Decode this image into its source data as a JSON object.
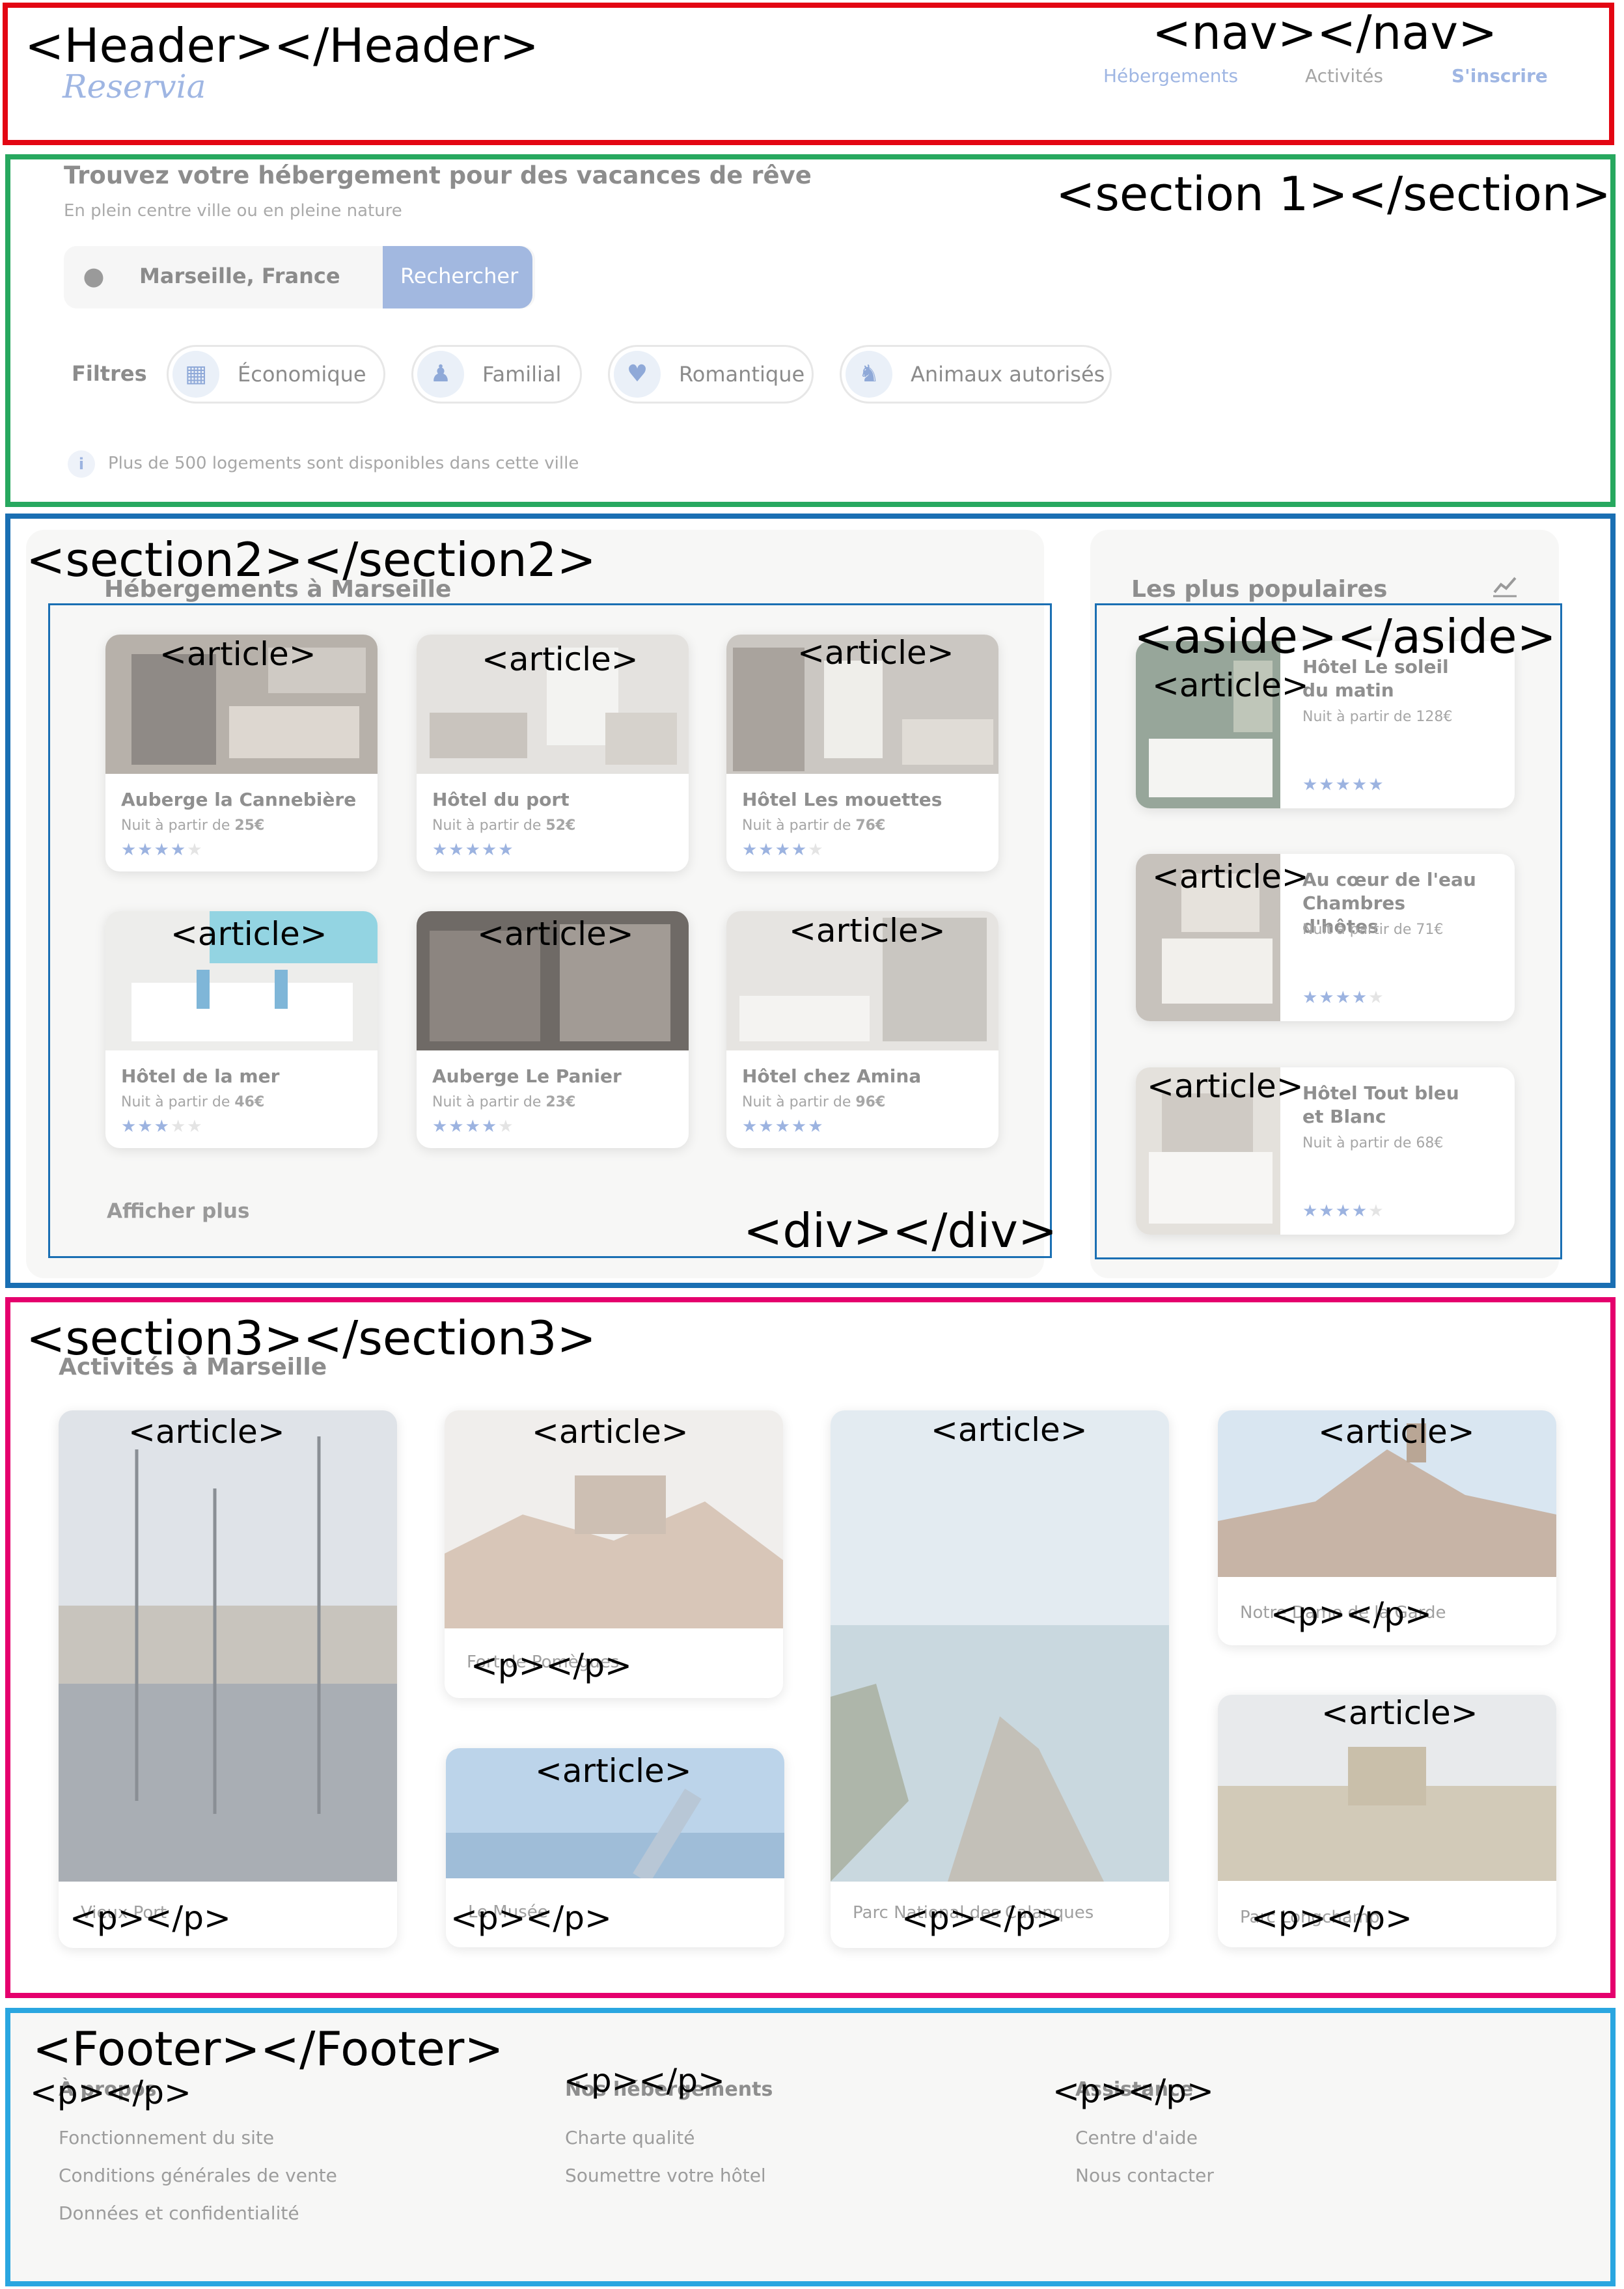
{
  "annotations": {
    "header": "<Header></Header>",
    "nav": "<nav></nav>",
    "section1": "<section 1></section>",
    "section2": "<section2></section2>",
    "aside": "<aside></aside>",
    "div": "<div></div>",
    "section3": "<section3></section3>",
    "footer": "<Footer></Footer>",
    "article": "<article>",
    "p": "<p></p>"
  },
  "header": {
    "logo": "Reservia",
    "nav": [
      "Hébergements",
      "Activités",
      "S'inscrire"
    ]
  },
  "search": {
    "title": "Trouvez votre hébergement pour des vacances de rêve",
    "subtitle": "En plein centre ville ou en pleine nature",
    "location": "Marseille, France",
    "button": "Rechercher",
    "filters_label": "Filtres",
    "filters": [
      {
        "label": "Économique",
        "icon": "money-icon"
      },
      {
        "label": "Familial",
        "icon": "family-icon"
      },
      {
        "label": "Romantique",
        "icon": "heart-icon"
      },
      {
        "label": "Animaux autorisés",
        "icon": "dog-icon"
      }
    ],
    "info": "Plus de 500 logements sont disponibles dans cette ville"
  },
  "hebergements": {
    "title": "Hébergements à Marseille",
    "items": [
      {
        "name": "Auberge la Cannebière",
        "price_prefix": "Nuit à partir de ",
        "price": "25€",
        "rating": 4
      },
      {
        "name": "Hôtel du port",
        "price_prefix": "Nuit à partir de ",
        "price": "52€",
        "rating": 5
      },
      {
        "name": "Hôtel Les mouettes",
        "price_prefix": "Nuit à partir de ",
        "price": "76€",
        "rating": 4
      },
      {
        "name": "Hôtel de la mer",
        "price_prefix": "Nuit à partir de ",
        "price": "46€",
        "rating": 3
      },
      {
        "name": "Auberge Le Panier",
        "price_prefix": "Nuit à partir de ",
        "price": "23€",
        "rating": 4
      },
      {
        "name": "Hôtel chez Amina",
        "price_prefix": "Nuit à partir de ",
        "price": "96€",
        "rating": 5
      }
    ],
    "more": "Afficher plus"
  },
  "populaires": {
    "title": "Les plus populaires",
    "items": [
      {
        "name": "Hôtel Le soleil du matin",
        "price_prefix": "Nuit à partir de ",
        "price": "128€",
        "rating": 5
      },
      {
        "name": "Au cœur de l'eau Chambres d'hôtes",
        "price_prefix": "Nuit à partir de ",
        "price": "71€",
        "rating": 4
      },
      {
        "name": "Hôtel Tout bleu et Blanc",
        "price_prefix": "Nuit à partir de ",
        "price": "68€",
        "rating": 4
      }
    ]
  },
  "activites": {
    "title": "Activités à Marseille",
    "items": [
      "Vieux Port",
      "Fort de Pomègues",
      "Le Musée",
      "Parc National des Calanques",
      "Notre Dame de la Garde",
      "Parc Longchamp"
    ]
  },
  "footer": {
    "columns": [
      {
        "title": "À propos",
        "links": [
          "Fonctionnement du site",
          "Conditions générales de vente",
          "Données et confidentialité"
        ]
      },
      {
        "title": "Nos hébergements",
        "links": [
          "Charte qualité",
          "Soumettre votre hôtel"
        ]
      },
      {
        "title": "Assistance",
        "links": [
          "Centre d'aide",
          "Nous contacter"
        ]
      }
    ]
  },
  "colors": {
    "header_border": "#e30613",
    "section1_border": "#27a85f",
    "section2_border": "#1a6fb3",
    "section3_border": "#e5006d",
    "footer_border": "#2aa6e0",
    "accent": "#9cb3e0"
  }
}
